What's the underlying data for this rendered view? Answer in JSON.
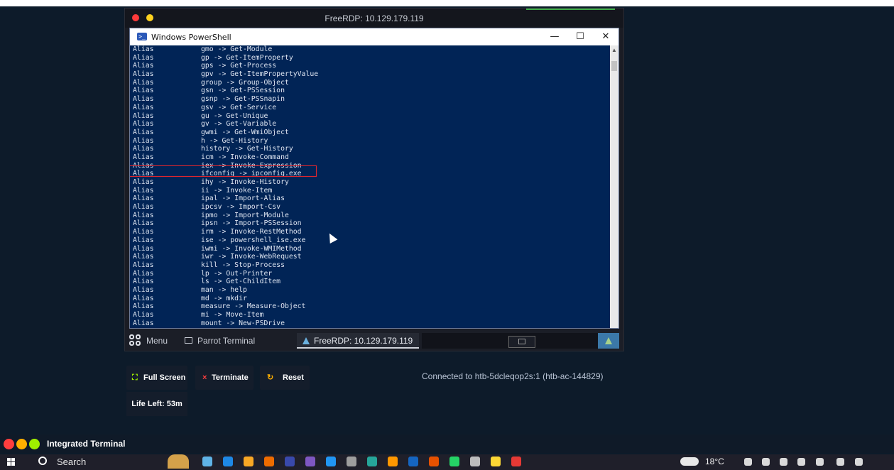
{
  "rdp_window": {
    "title": "FreeRDP: 10.129.179.119"
  },
  "powershell": {
    "title": "Windows PowerShell",
    "controls": {
      "minimize": "—",
      "maximize": "☐",
      "close": "✕"
    },
    "lines": [
      {
        "type": "Alias",
        "text": "gmo -> Get-Module"
      },
      {
        "type": "Alias",
        "text": "gp -> Get-ItemProperty"
      },
      {
        "type": "Alias",
        "text": "gps -> Get-Process"
      },
      {
        "type": "Alias",
        "text": "gpv -> Get-ItemPropertyValue"
      },
      {
        "type": "Alias",
        "text": "group -> Group-Object"
      },
      {
        "type": "Alias",
        "text": "gsn -> Get-PSSession"
      },
      {
        "type": "Alias",
        "text": "gsnp -> Get-PSSnapin"
      },
      {
        "type": "Alias",
        "text": "gsv -> Get-Service"
      },
      {
        "type": "Alias",
        "text": "gu -> Get-Unique"
      },
      {
        "type": "Alias",
        "text": "gv -> Get-Variable"
      },
      {
        "type": "Alias",
        "text": "gwmi -> Get-WmiObject"
      },
      {
        "type": "Alias",
        "text": "h -> Get-History"
      },
      {
        "type": "Alias",
        "text": "history -> Get-History"
      },
      {
        "type": "Alias",
        "text": "icm -> Invoke-Command"
      },
      {
        "type": "Alias",
        "text": "iex -> Invoke-Expression"
      },
      {
        "type": "Alias",
        "text": "ifconfig -> ipconfig.exe"
      },
      {
        "type": "Alias",
        "text": "ihy -> Invoke-History"
      },
      {
        "type": "Alias",
        "text": "ii -> Invoke-Item"
      },
      {
        "type": "Alias",
        "text": "ipal -> Import-Alias"
      },
      {
        "type": "Alias",
        "text": "ipcsv -> Import-Csv"
      },
      {
        "type": "Alias",
        "text": "ipmo -> Import-Module"
      },
      {
        "type": "Alias",
        "text": "ipsn -> Import-PSSession"
      },
      {
        "type": "Alias",
        "text": "irm -> Invoke-RestMethod"
      },
      {
        "type": "Alias",
        "text": "ise -> powershell_ise.exe"
      },
      {
        "type": "Alias",
        "text": "iwmi -> Invoke-WMIMethod"
      },
      {
        "type": "Alias",
        "text": "iwr -> Invoke-WebRequest"
      },
      {
        "type": "Alias",
        "text": "kill -> Stop-Process"
      },
      {
        "type": "Alias",
        "text": "lp -> Out-Printer"
      },
      {
        "type": "Alias",
        "text": "ls -> Get-ChildItem"
      },
      {
        "type": "Alias",
        "text": "man -> help"
      },
      {
        "type": "Alias",
        "text": "md -> mkdir"
      },
      {
        "type": "Alias",
        "text": "measure -> Measure-Object"
      },
      {
        "type": "Alias",
        "text": "mi -> Move-Item"
      },
      {
        "type": "Alias",
        "text": "mount -> New-PSDrive"
      }
    ]
  },
  "parrot_taskbar": {
    "menu_label": "Menu",
    "terminal_label": "Parrot Terminal",
    "rdp_label": "FreeRDP: 10.129.179.119"
  },
  "controls": {
    "full_screen": "Full Screen",
    "terminate": "Terminate",
    "reset": "Reset",
    "life_left": "Life Left: 53m",
    "connected": "Connected to htb-5dcleqop2s:1 (htb-ac-144829)"
  },
  "integrated_terminal": {
    "label": "Integrated Terminal"
  },
  "windows_taskbar": {
    "search_label": "Search",
    "temperature": "18°C",
    "app_colors": [
      "#5fb3e6",
      "#1e88e5",
      "#f9a825",
      "#ef6c00",
      "#3949ab",
      "#7e57c2",
      "#2196f3",
      "#9e9e9e",
      "#26a69a",
      "#ff9800",
      "#1565c0",
      "#e65100",
      "#25d366",
      "#bdbdbd",
      "#fdd835",
      "#e53935"
    ]
  },
  "colors": {
    "terminal_bg": "#012456",
    "highlight_box": "#e0262d",
    "htb_green": "#9fef00"
  }
}
